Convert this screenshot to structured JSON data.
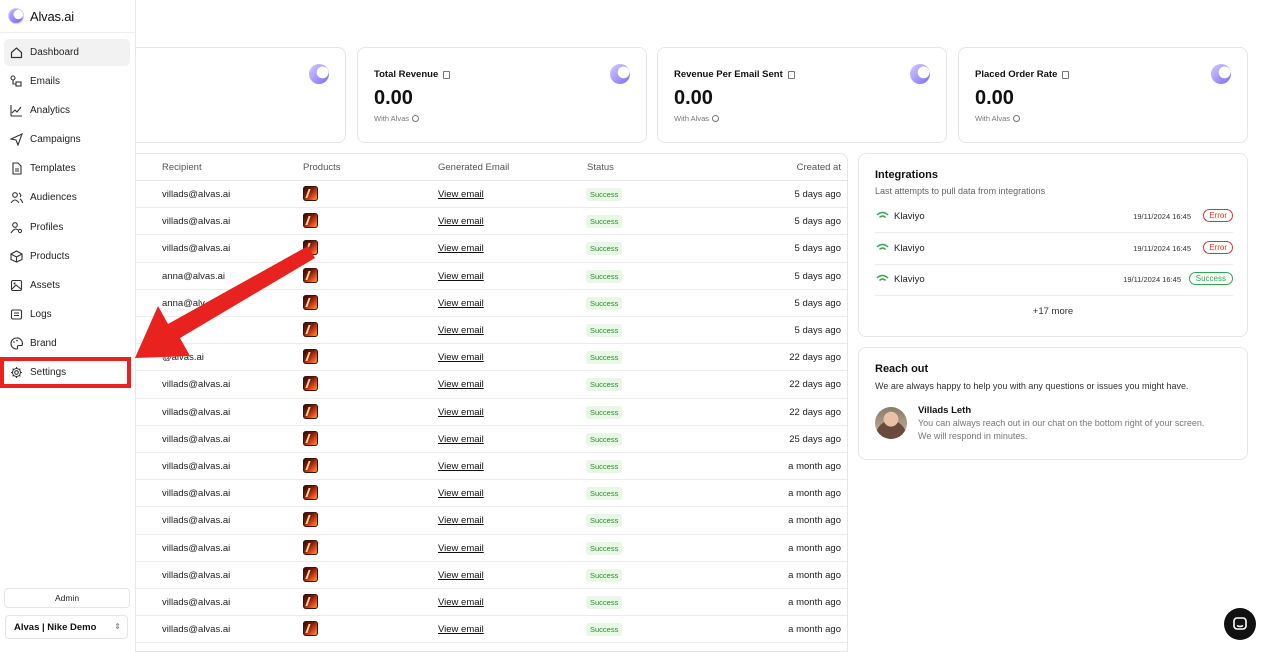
{
  "app": {
    "name": "Alvas.ai"
  },
  "sidebar": {
    "items": [
      {
        "label": "Dashboard",
        "icon": "home-icon",
        "active": true
      },
      {
        "label": "Emails",
        "icon": "email-flow-icon"
      },
      {
        "label": "Analytics",
        "icon": "chart-line-icon"
      },
      {
        "label": "Campaigns",
        "icon": "send-icon"
      },
      {
        "label": "Templates",
        "icon": "file-icon"
      },
      {
        "label": "Audiences",
        "icon": "users-icon"
      },
      {
        "label": "Profiles",
        "icon": "user-search-icon"
      },
      {
        "label": "Products",
        "icon": "package-icon"
      },
      {
        "label": "Assets",
        "icon": "image-icon"
      },
      {
        "label": "Logs",
        "icon": "logs-icon"
      },
      {
        "label": "Brand",
        "icon": "palette-icon"
      },
      {
        "label": "Settings",
        "icon": "gear-icon"
      }
    ],
    "admin_label": "Admin",
    "workspace": "Alvas | Nike Demo"
  },
  "stats": [
    {
      "title": "",
      "value": "",
      "sub": ""
    },
    {
      "title": "Total Revenue",
      "value": "0.00",
      "sub": "With Alvas"
    },
    {
      "title": "Revenue Per Email Sent",
      "value": "0.00",
      "sub": "With Alvas"
    },
    {
      "title": "Placed Order Rate",
      "value": "0.00",
      "sub": "With Alvas"
    }
  ],
  "table": {
    "headers": {
      "recipient": "Recipient",
      "products": "Products",
      "generated": "Generated Email",
      "status": "Status",
      "created": "Created at"
    },
    "rows": [
      {
        "recipient": "villads@alvas.ai",
        "link": "View email",
        "status": "Success",
        "created": "5 days ago"
      },
      {
        "recipient": "villads@alvas.ai",
        "link": "View email",
        "status": "Success",
        "created": "5 days ago"
      },
      {
        "recipient": "villads@alvas.ai",
        "link": "View email",
        "status": "Success",
        "created": "5 days ago"
      },
      {
        "recipient": "anna@alvas.ai",
        "link": "View email",
        "status": "Success",
        "created": "5 days ago"
      },
      {
        "recipient": "anna@alv",
        "link": "View email",
        "status": "Success",
        "created": "5 days ago"
      },
      {
        "recipient": "as.ai",
        "link": "View email",
        "status": "Success",
        "created": "5 days ago"
      },
      {
        "recipient": "@alvas.ai",
        "link": "View email",
        "status": "Success",
        "created": "22 days ago"
      },
      {
        "recipient": "villads@alvas.ai",
        "link": "View email",
        "status": "Success",
        "created": "22 days ago"
      },
      {
        "recipient": "villads@alvas.ai",
        "link": "View email",
        "status": "Success",
        "created": "22 days ago"
      },
      {
        "recipient": "villads@alvas.ai",
        "link": "View email",
        "status": "Success",
        "created": "25 days ago"
      },
      {
        "recipient": "villads@alvas.ai",
        "link": "View email",
        "status": "Success",
        "created": "a month ago"
      },
      {
        "recipient": "villads@alvas.ai",
        "link": "View email",
        "status": "Success",
        "created": "a month ago"
      },
      {
        "recipient": "villads@alvas.ai",
        "link": "View email",
        "status": "Success",
        "created": "a month ago"
      },
      {
        "recipient": "villads@alvas.ai",
        "link": "View email",
        "status": "Success",
        "created": "a month ago"
      },
      {
        "recipient": "villads@alvas.ai",
        "link": "View email",
        "status": "Success",
        "created": "a month ago"
      },
      {
        "recipient": "villads@alvas.ai",
        "link": "View email",
        "status": "Success",
        "created": "a month ago"
      },
      {
        "recipient": "villads@alvas.ai",
        "link": "View email",
        "status": "Success",
        "created": "a month ago"
      }
    ]
  },
  "integrations": {
    "title": "Integrations",
    "subtitle": "Last attempts to pull data from integrations",
    "items": [
      {
        "name": "Klaviyo",
        "time": "19/11/2024 16:45",
        "status": "Error"
      },
      {
        "name": "Klaviyo",
        "time": "19/11/2024 16:45",
        "status": "Error"
      },
      {
        "name": "Klaviyo",
        "time": "19/11/2024 16:45",
        "status": "Success"
      }
    ],
    "more": "+17 more"
  },
  "reach": {
    "title": "Reach out",
    "subtitle": "We are always happy to help you with any questions or issues you might have.",
    "name": "Villads Leth",
    "line1": "You can always reach out in our chat on the bottom right of your screen.",
    "line2": "We will respond in minutes."
  },
  "colors": {
    "accent": "#7a6cf5",
    "annotation": "#e8231f",
    "success": "#2fa84f",
    "error": "#e03535"
  }
}
